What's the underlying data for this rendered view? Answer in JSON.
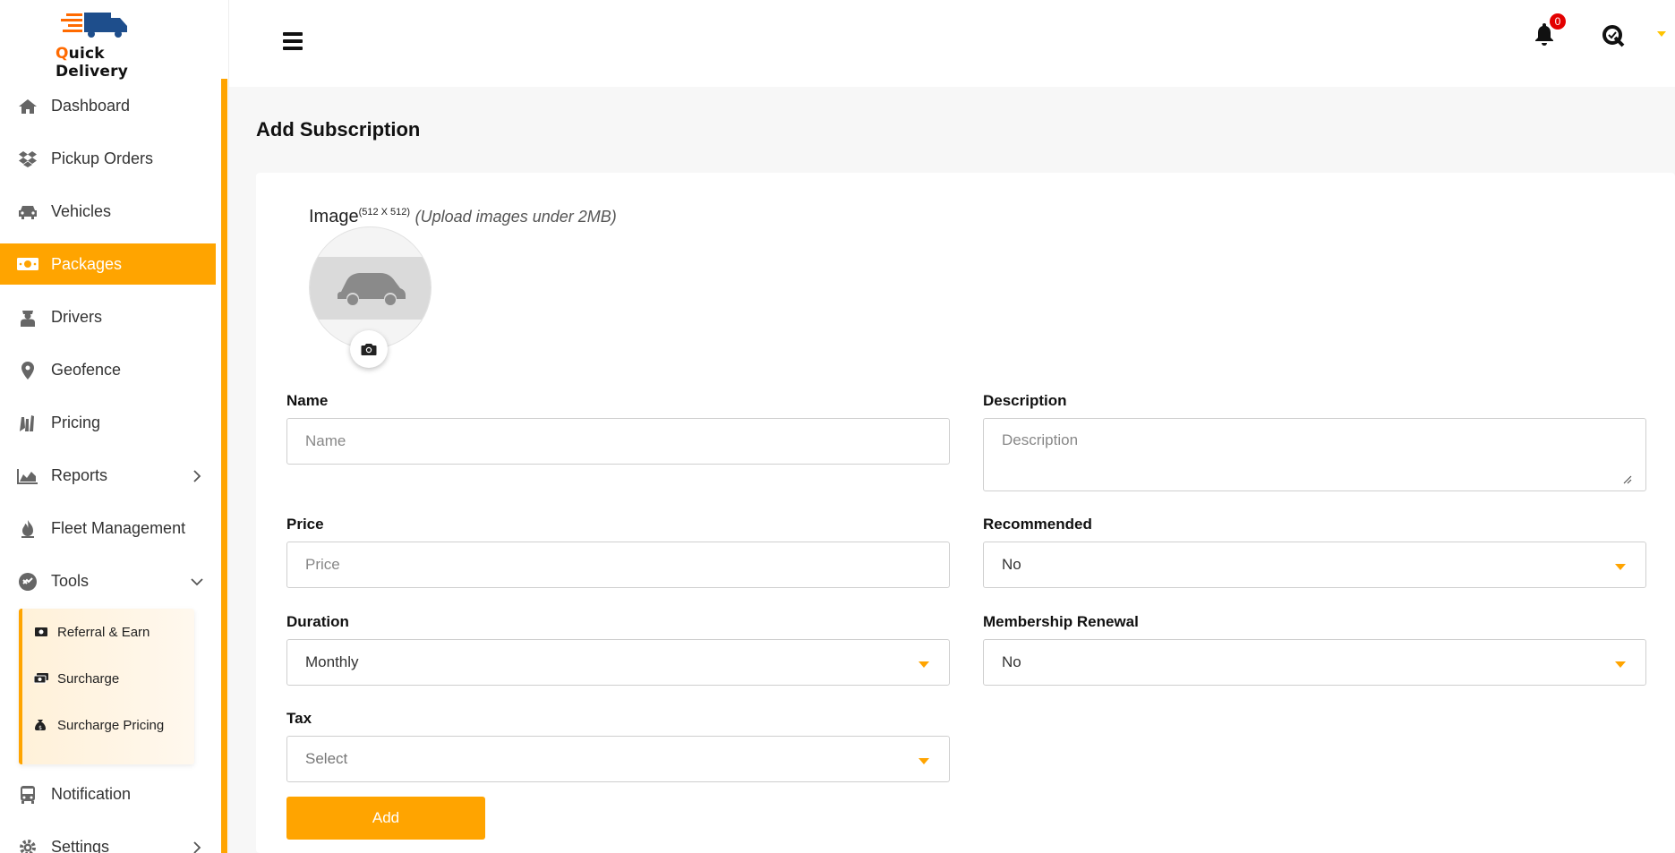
{
  "brand": {
    "logo_q": "Q",
    "logo_rest": "uick Delivery",
    "accent_color": "#ffa400",
    "logo_icon": "delivery-truck-icon"
  },
  "sidebar": {
    "items": [
      {
        "label": "Dashboard",
        "icon": "home-icon"
      },
      {
        "label": "Pickup Orders",
        "icon": "dropbox-icon"
      },
      {
        "label": "Vehicles",
        "icon": "car-icon"
      },
      {
        "label": "Packages",
        "icon": "money-bill-icon",
        "active": true
      },
      {
        "label": "Drivers",
        "icon": "driver-icon"
      },
      {
        "label": "Geofence",
        "icon": "map-marker-icon"
      },
      {
        "label": "Pricing",
        "icon": "pricing-icon"
      },
      {
        "label": "Reports",
        "icon": "area-chart-icon"
      },
      {
        "label": "Fleet Management",
        "icon": "fire-icon"
      },
      {
        "label": "Tools",
        "icon": "tools-icon"
      },
      {
        "label": "Notification",
        "icon": "bus-icon"
      },
      {
        "label": "Settings",
        "icon": "gear-icon"
      }
    ],
    "tools_submenu": [
      {
        "label": "Referral & Earn",
        "icon": "money-bill-icon"
      },
      {
        "label": "Surcharge",
        "icon": "money-bills-icon"
      },
      {
        "label": "Surcharge Pricing",
        "icon": "money-bag-icon"
      }
    ]
  },
  "topbar": {
    "notification_count": "0"
  },
  "page": {
    "title": "Add Subscription",
    "image_label": "Image",
    "image_size": "(512 X 512)",
    "image_hint": "(Upload images under 2MB)"
  },
  "form": {
    "name": {
      "label": "Name",
      "placeholder": "Name",
      "value": ""
    },
    "description": {
      "label": "Description",
      "placeholder": "Description",
      "value": ""
    },
    "price": {
      "label": "Price",
      "placeholder": "Price",
      "value": ""
    },
    "recommended": {
      "label": "Recommended",
      "selected": "No"
    },
    "duration": {
      "label": "Duration",
      "selected": "Monthly"
    },
    "membership_renewal": {
      "label": "Membership Renewal",
      "selected": "No"
    },
    "tax": {
      "label": "Tax",
      "selected": "Select"
    },
    "submit_label": "Add"
  }
}
